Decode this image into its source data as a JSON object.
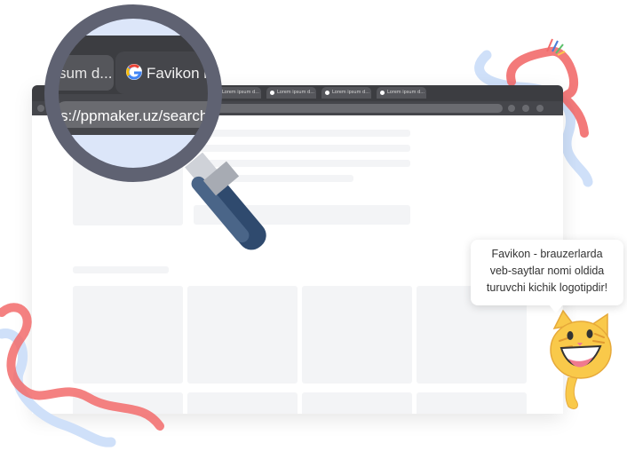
{
  "browser": {
    "tabs": [
      {
        "label": "Lorem ipsum d..."
      },
      {
        "label": "Lorem ipsum d..."
      },
      {
        "label": "Lorem ipsum d..."
      },
      {
        "label": "Lorem ipsum d..."
      }
    ]
  },
  "magnifier": {
    "tab_left_label": "sum d...",
    "tab_active_label": "Favikon r",
    "url_text": "s://ppmaker.uz/search"
  },
  "bubble": {
    "line1": "Favikon - brauzerlarda",
    "line2": "veb-saytlar nomi oldida",
    "line3": "turuvchi kichik logotipdir!"
  },
  "colors": {
    "browser_dark": "#3c3d41",
    "ribbon_red": "#f26b6b",
    "ribbon_blue": "#cfe0f9",
    "magnifier_frame": "#5f6272",
    "handle_navy": "#2f4a6e",
    "cat_yellow": "#f9c94a"
  }
}
